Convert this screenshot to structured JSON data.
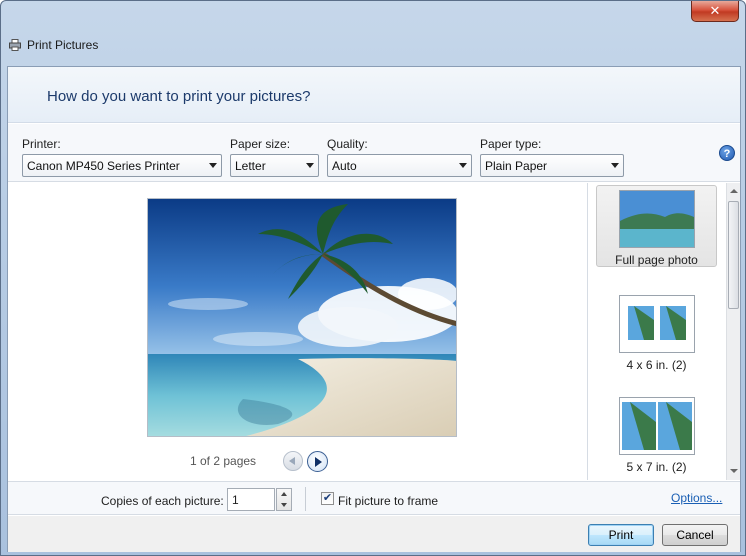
{
  "window": {
    "title": "Print Pictures",
    "close_label": "✕"
  },
  "header": {
    "question": "How do you want to print your pictures?"
  },
  "options": {
    "printer_label": "Printer:",
    "printer_value": "Canon MP450 Series Printer",
    "paper_size_label": "Paper size:",
    "paper_size_value": "Letter",
    "quality_label": "Quality:",
    "quality_value": "Auto",
    "paper_type_label": "Paper type:",
    "paper_type_value": "Plain Paper",
    "help_label": "?"
  },
  "preview": {
    "page_info": "1 of 2 pages"
  },
  "layouts": [
    {
      "caption": "Full page photo",
      "selected": true
    },
    {
      "caption": "4 x 6 in. (2)",
      "selected": false
    },
    {
      "caption": "5 x 7 in. (2)",
      "selected": false
    }
  ],
  "bottom": {
    "copies_label": "Copies of each picture:",
    "copies_value": "1",
    "fit_checked": true,
    "fit_label": "Fit picture to frame",
    "options_link": "Options..."
  },
  "footer": {
    "print_label": "Print",
    "cancel_label": "Cancel"
  },
  "colors": {
    "accent": "#1a5fb4",
    "heading": "#1c3a6b"
  }
}
